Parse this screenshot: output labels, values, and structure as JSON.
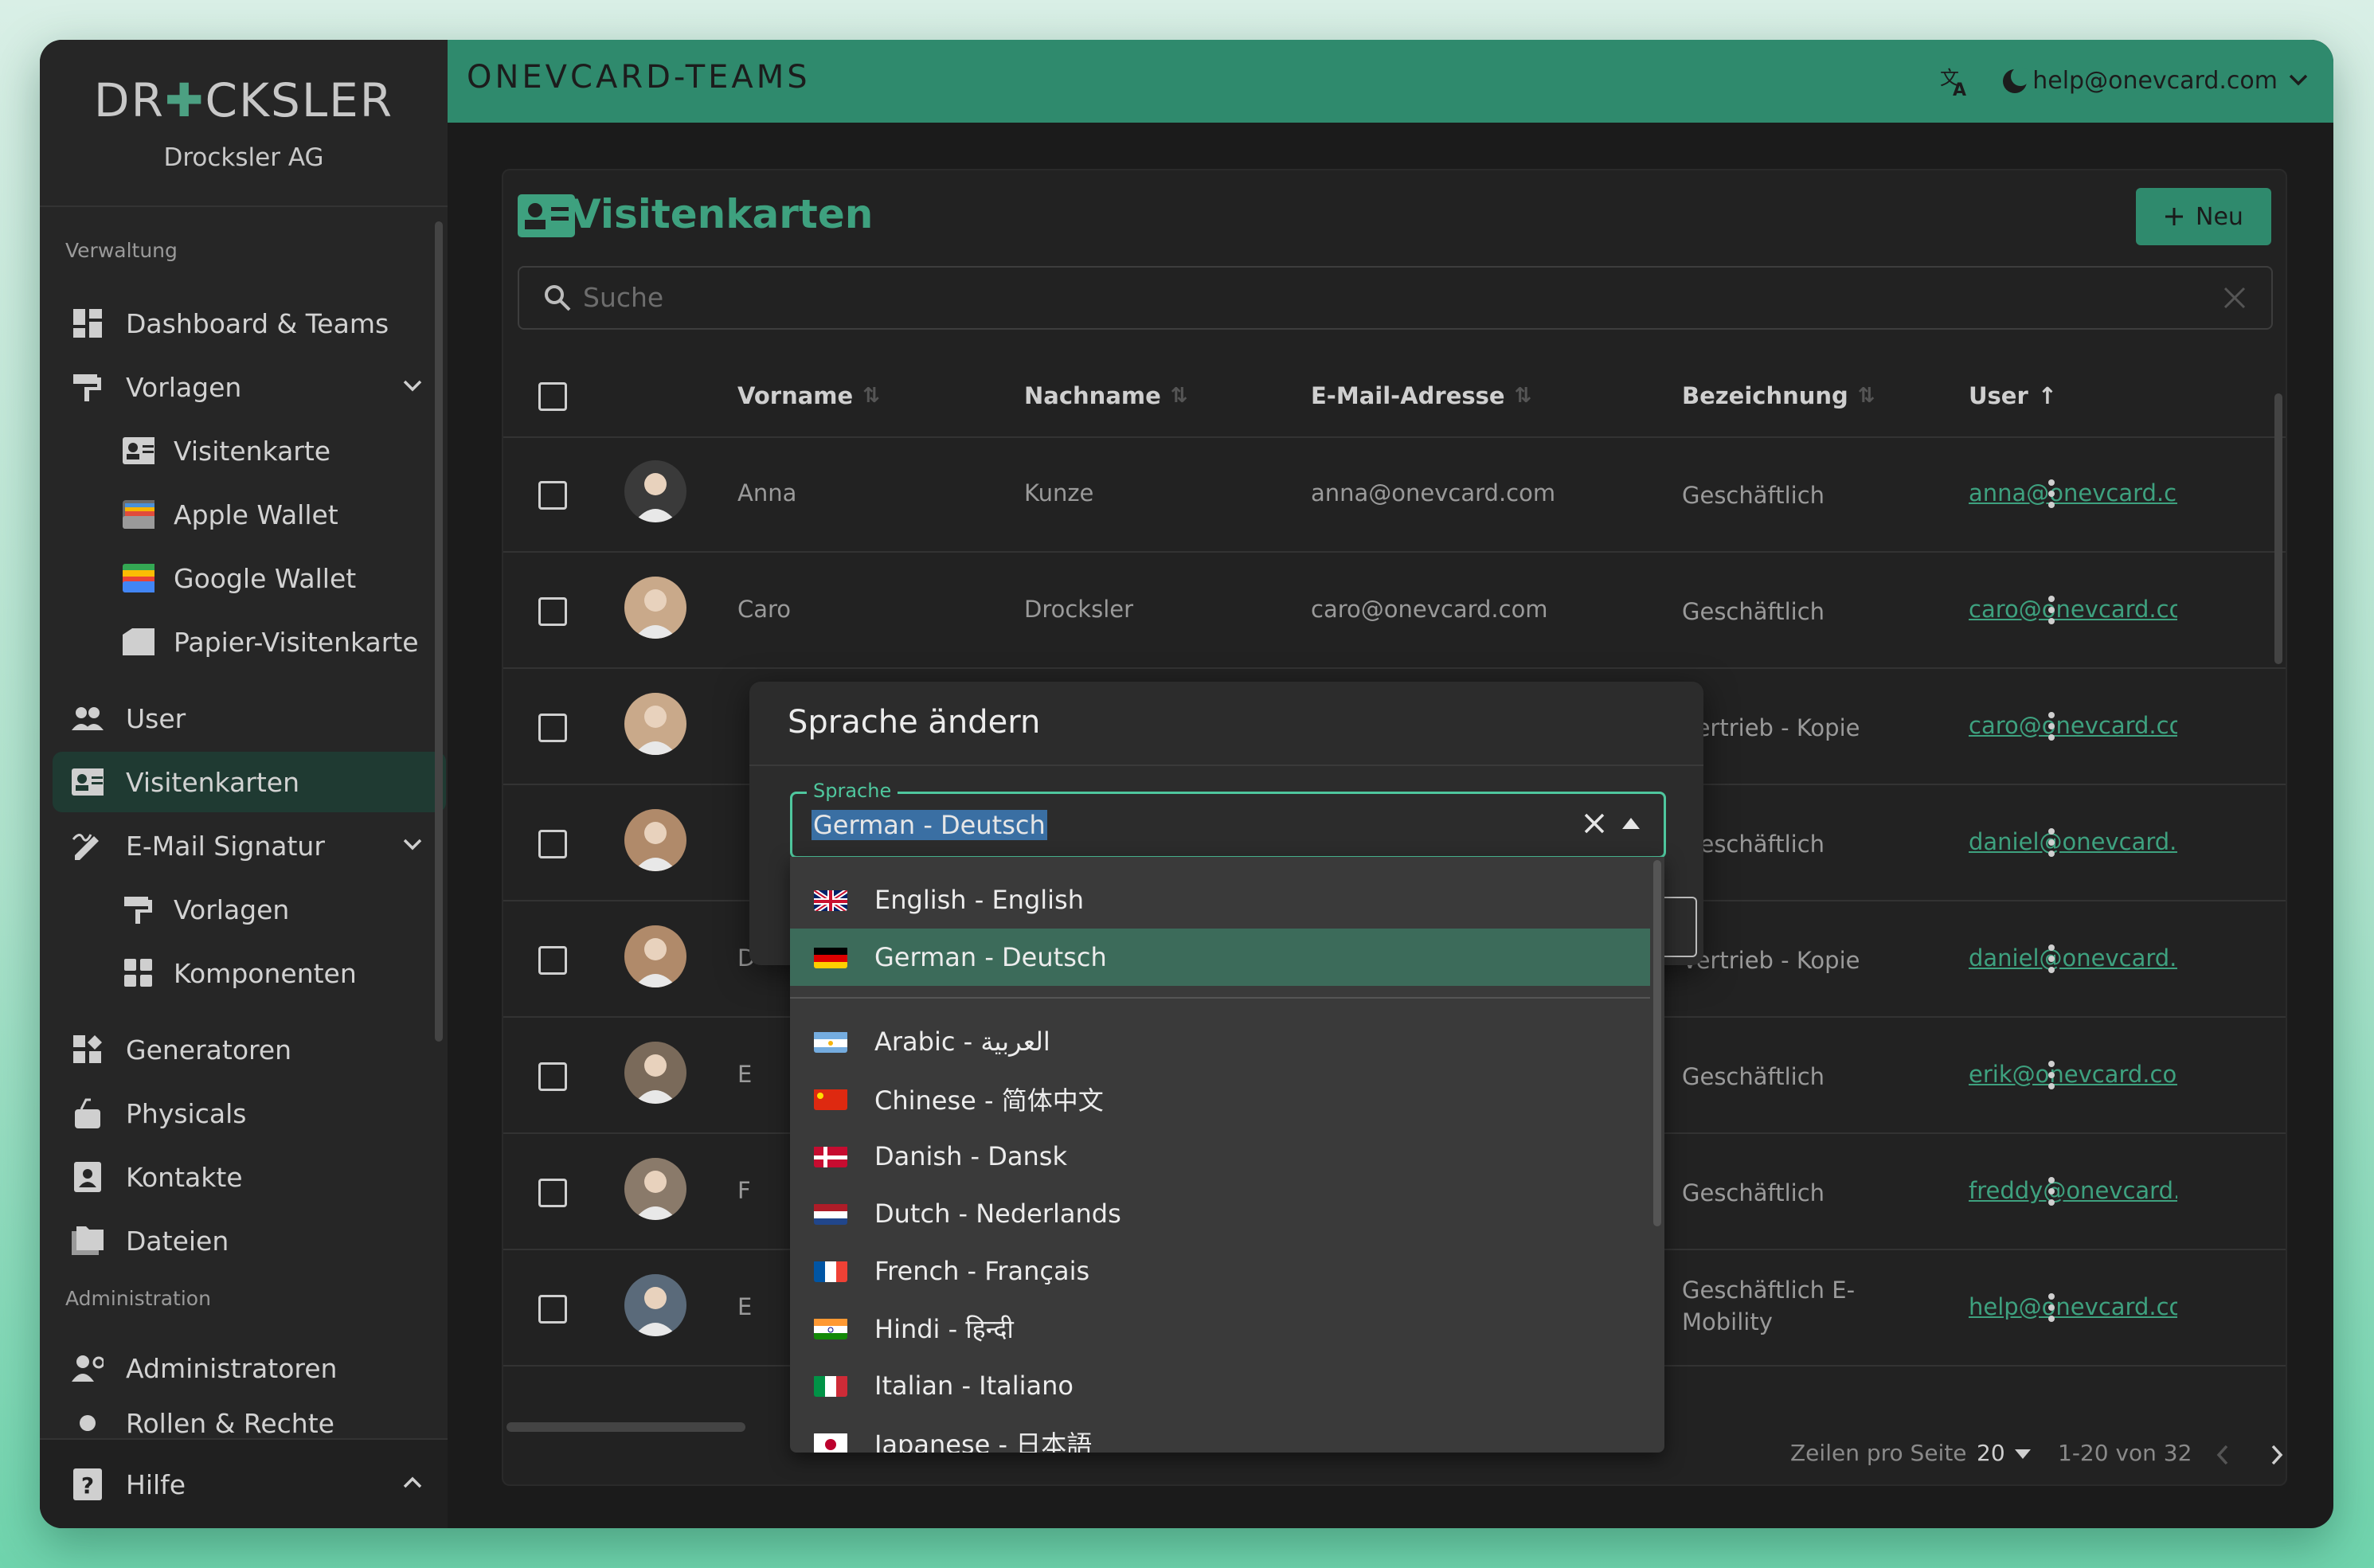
{
  "sidebar": {
    "logo": "DR#CKSLER",
    "org": "Drocksler AG",
    "section_admin": "Verwaltung",
    "items": [
      {
        "label": "Dashboard & Teams"
      },
      {
        "label": "Vorlagen"
      },
      {
        "label": "Visitenkarte"
      },
      {
        "label": "Apple Wallet"
      },
      {
        "label": "Google Wallet"
      },
      {
        "label": "Papier-Visitenkarte"
      },
      {
        "label": "User"
      },
      {
        "label": "Visitenkarten"
      },
      {
        "label": "E-Mail Signatur"
      },
      {
        "label": "Vorlagen"
      },
      {
        "label": "Komponenten"
      },
      {
        "label": "Generatoren"
      },
      {
        "label": "Physicals"
      },
      {
        "label": "Kontakte"
      },
      {
        "label": "Dateien"
      }
    ],
    "section_administration": "Administration",
    "admin_items": [
      {
        "label": "Administratoren"
      },
      {
        "label": "Rollen & Rechte"
      }
    ],
    "help": "Hilfe"
  },
  "topbar": {
    "product": "ONEVCARD-TEAMS",
    "account": "help@onevcard.com"
  },
  "page": {
    "title": "Visitenkarten",
    "new_button": "Neu",
    "search_placeholder": "Suche"
  },
  "table": {
    "columns": [
      "Vorname",
      "Nachname",
      "E-Mail-Adresse",
      "Bezeichnung",
      "User"
    ],
    "rows": [
      {
        "first": "Anna",
        "last": "Kunze",
        "email": "anna@onevcard.com",
        "desc": "Geschäftlich",
        "user": "anna@onevcard.com"
      },
      {
        "first": "Caro",
        "last": "Drocksler",
        "email": "caro@onevcard.com",
        "desc": "Geschäftlich",
        "user": "caro@onevcard.com"
      },
      {
        "first": "",
        "last": "",
        "email": "",
        "desc": "Vertrieb - Kopie",
        "user": "caro@onevcard.com"
      },
      {
        "first": "",
        "last": "",
        "email": "",
        "desc": "Geschäftlich",
        "user": "daniel@onevcard.com"
      },
      {
        "first": "D",
        "last": "",
        "email": "",
        "desc": "Vertrieb - Kopie",
        "user": "daniel@onevcard.com"
      },
      {
        "first": "E",
        "last": "",
        "email": "",
        "desc": "Geschäftlich",
        "user": "erik@onevcard.com"
      },
      {
        "first": "F",
        "last": "",
        "email": "",
        "desc": "Geschäftlich",
        "user": "freddy@onevcard.com"
      },
      {
        "first": "E",
        "last": "",
        "email": "",
        "desc": "Geschäftlich E-Mobility",
        "user": "help@onevcard.com"
      }
    ]
  },
  "pagination": {
    "rows_per_page_label": "Zeilen pro Seite",
    "rows_per_page": "20",
    "range": "1-20 von 32"
  },
  "dialog": {
    "title": "Sprache ändern",
    "field_label": "Sprache",
    "field_value": "German - Deutsch",
    "options_top": [
      {
        "label": "English - English",
        "flag": "gb"
      },
      {
        "label": "German - Deutsch",
        "flag": "de"
      }
    ],
    "options": [
      {
        "label": "Arabic - العربية",
        "flag": "ar"
      },
      {
        "label": "Chinese - 简体中文",
        "flag": "cn"
      },
      {
        "label": "Danish - Dansk",
        "flag": "dk"
      },
      {
        "label": "Dutch - Nederlands",
        "flag": "nl"
      },
      {
        "label": "French - Français",
        "flag": "fr"
      },
      {
        "label": "Hindi - हिन्दी",
        "flag": "in"
      },
      {
        "label": "Italian - Italiano",
        "flag": "it"
      },
      {
        "label": "Japanese - 日本語",
        "flag": "jp"
      }
    ]
  },
  "colors": {
    "accent": "#2f8a6d",
    "accent_text": "#3ea17f",
    "focus": "#4fc79e"
  }
}
